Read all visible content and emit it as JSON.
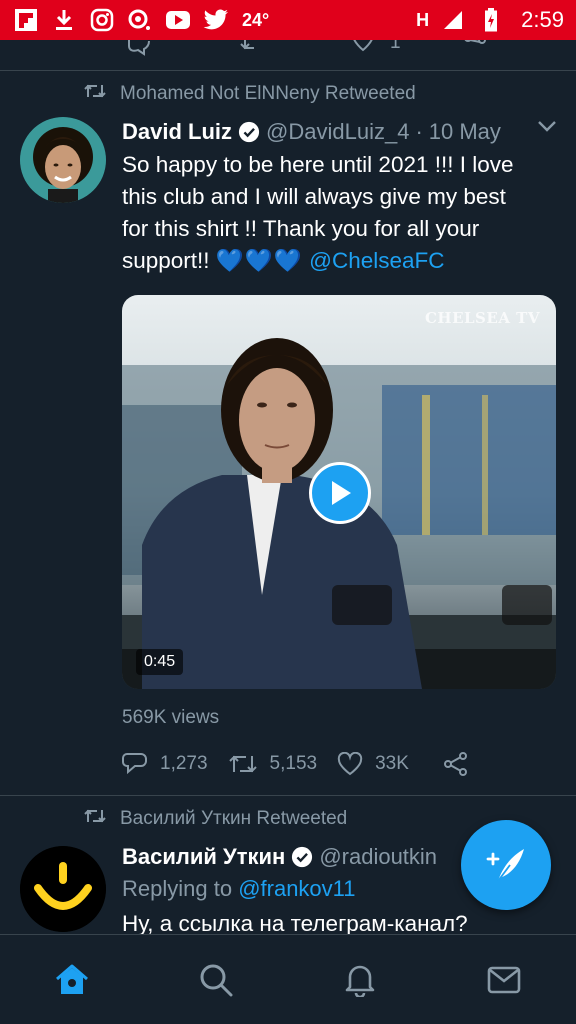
{
  "status_bar": {
    "temperature": "24°",
    "network": "H",
    "time": "2:59",
    "bg_color": "#e0001b"
  },
  "previous_tweet": {
    "like_count": "1"
  },
  "tweet1": {
    "retweeted_by": "Mohamed Not ElNNeny Retweeted",
    "author_name": "David Luiz",
    "handle": "@DavidLuiz_4",
    "separator": "·",
    "date": "10 May",
    "text_line1": "So happy to be here until 2021 !!! I love",
    "text_line2": "this club and I will always give my best",
    "text_line3": "for this shirt !! Thank you for all your",
    "text_line4_prefix": "support!! ",
    "hearts": "💙💙💙",
    "mention": "@ChelseaFC",
    "video_duration": "0:45",
    "watermark": "CHELSEA TV",
    "views": "569K views",
    "replies": "1,273",
    "retweets": "5,153",
    "likes": "33K"
  },
  "tweet2": {
    "retweeted_by": "Василий Уткин Retweeted",
    "author_name": "Василий Уткин",
    "handle": "@radioutkin",
    "replying_prefix": "Replying to ",
    "replying_to": "@frankov11",
    "text": "Ну, а ссылка на телеграм-канал?"
  },
  "colors": {
    "background": "#15202b",
    "accent": "#1da1f2",
    "muted": "#8899a6",
    "divider": "#38444d"
  },
  "nav": {
    "items": [
      "home-icon",
      "search-icon",
      "notifications-icon",
      "messages-icon"
    ],
    "active": "home-icon"
  }
}
